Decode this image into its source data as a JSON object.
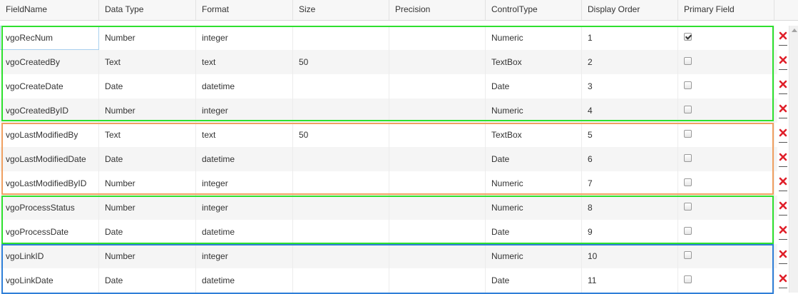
{
  "columns": [
    "FieldName",
    "Data Type",
    "Format",
    "Size",
    "Precision",
    "ControlType",
    "Display Order",
    "Primary Field"
  ],
  "rows": [
    {
      "field": "vgoRecNum",
      "type": "Number",
      "format": "integer",
      "size": "",
      "precision": "",
      "control": "Numeric",
      "order": "1",
      "primary": true
    },
    {
      "field": "vgoCreatedBy",
      "type": "Text",
      "format": "text",
      "size": "50",
      "precision": "",
      "control": "TextBox",
      "order": "2",
      "primary": false
    },
    {
      "field": "vgoCreateDate",
      "type": "Date",
      "format": "datetime",
      "size": "",
      "precision": "",
      "control": "Date",
      "order": "3",
      "primary": false
    },
    {
      "field": "vgoCreatedByID",
      "type": "Number",
      "format": "integer",
      "size": "",
      "precision": "",
      "control": "Numeric",
      "order": "4",
      "primary": false
    },
    {
      "field": "vgoLastModifiedBy",
      "type": "Text",
      "format": "text",
      "size": "50",
      "precision": "",
      "control": "TextBox",
      "order": "5",
      "primary": false
    },
    {
      "field": "vgoLastModifiedDate",
      "type": "Date",
      "format": "datetime",
      "size": "",
      "precision": "",
      "control": "Date",
      "order": "6",
      "primary": false
    },
    {
      "field": "vgoLastModifiedByID",
      "type": "Number",
      "format": "integer",
      "size": "",
      "precision": "",
      "control": "Numeric",
      "order": "7",
      "primary": false
    },
    {
      "field": "vgoProcessStatus",
      "type": "Number",
      "format": "integer",
      "size": "",
      "precision": "",
      "control": "Numeric",
      "order": "8",
      "primary": false
    },
    {
      "field": "vgoProcessDate",
      "type": "Date",
      "format": "datetime",
      "size": "",
      "precision": "",
      "control": "Date",
      "order": "9",
      "primary": false
    },
    {
      "field": "vgoLinkID",
      "type": "Number",
      "format": "integer",
      "size": "",
      "precision": "",
      "control": "Numeric",
      "order": "10",
      "primary": false
    },
    {
      "field": "vgoLinkDate",
      "type": "Date",
      "format": "datetime",
      "size": "",
      "precision": "",
      "control": "Date",
      "order": "11",
      "primary": false
    }
  ],
  "icons": {
    "delete": "delete-x-icon",
    "checkbox": "checkbox-icon",
    "scroll_up": "scroll-up-arrow-icon"
  },
  "colors": {
    "group_green": "#2ee02e",
    "group_orange": "#f0a060",
    "group_blue": "#2f7fd8",
    "delete_red": "#e0202a"
  }
}
